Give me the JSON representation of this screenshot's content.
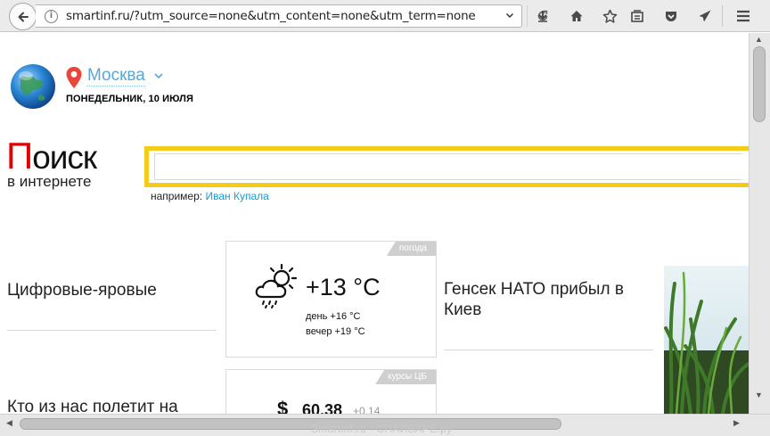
{
  "browser": {
    "url": "smartinf.ru/?utm_source=none&utm_content=none&utm_term=none",
    "toolbar_icons": [
      "back-arrow-icon",
      "info-icon",
      "dropdown-chevron-icon",
      "reload-icon",
      "download-icon",
      "home-icon",
      "star-icon",
      "reading-list-icon",
      "pocket-icon",
      "send-icon",
      "hamburger-menu-icon"
    ]
  },
  "header": {
    "city": "Москва",
    "date": "ПОНЕДЕЛЬНИК, 10 ИЮЛЯ"
  },
  "logo": {
    "first_letter": "П",
    "rest": "оиск",
    "subtitle": "в интернете"
  },
  "search": {
    "placeholder": "",
    "example_label": "например:",
    "example_link": "Иван Купала"
  },
  "news": {
    "left_1": "Цифровые-яровые",
    "left_2": "Кто из нас полетит на",
    "right_1": "Генсек НАТО прибыл в Киев"
  },
  "weather": {
    "tag": "погода",
    "temp": "+13 °C",
    "day": "день +16 °C",
    "evening": "вечер +19 °C"
  },
  "rates": {
    "tag": "курсы ЦБ",
    "symbol": "$",
    "value": "60.38",
    "delta": "+0.14"
  },
  "watermark": "Smartinf.ru - СПАЙВАРЕ.ру",
  "colors": {
    "search_border": "#f2cc18",
    "city_link": "#5aa6d4",
    "example_link": "#1a9ad0",
    "logo_red": "#e00000"
  }
}
